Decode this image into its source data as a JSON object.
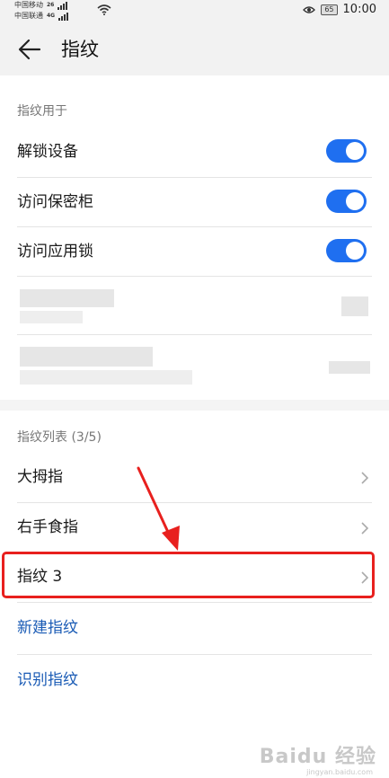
{
  "status_bar": {
    "carrier1": "中国移动",
    "carrier1_tag": "26",
    "carrier2": "中国联通",
    "carrier2_tag": "4G",
    "battery": "65",
    "time": "10:00"
  },
  "header": {
    "title": "指纹",
    "back_icon": "back-arrow-icon"
  },
  "usage_section": {
    "label": "指纹用于",
    "items": [
      {
        "label": "解锁设备",
        "toggle_on": true
      },
      {
        "label": "访问保密柜",
        "toggle_on": true
      },
      {
        "label": "访问应用锁",
        "toggle_on": true
      }
    ]
  },
  "list_section": {
    "label": "指纹列表 (3/5)",
    "items": [
      {
        "label": "大拇指"
      },
      {
        "label": "右手食指"
      },
      {
        "label": "指纹 3"
      }
    ]
  },
  "actions": {
    "new_fingerprint": "新建指纹",
    "identify_fingerprint": "识别指纹"
  },
  "watermark": {
    "text": "Baidu 经验",
    "sub": "jingyan.baidu.com"
  },
  "colors": {
    "accent": "#1f6ff0",
    "link": "#1a5bb5",
    "highlight": "#e8201e"
  }
}
